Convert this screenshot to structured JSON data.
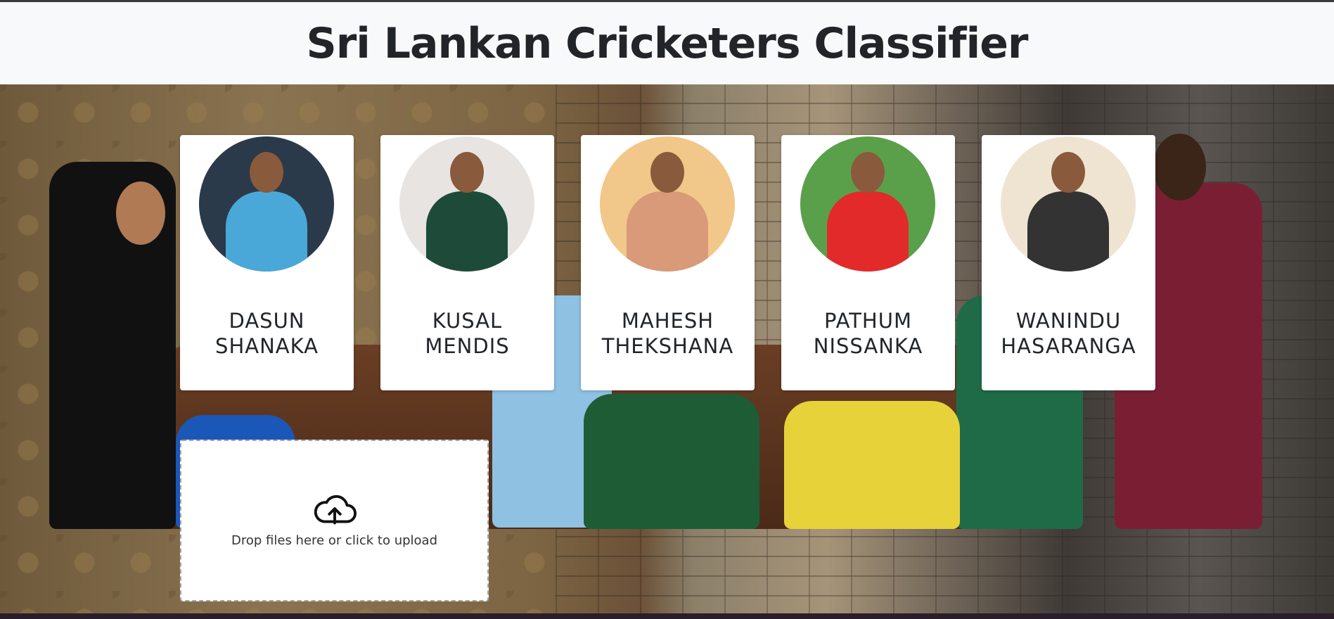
{
  "header": {
    "title": "Sri Lankan Cricketers Classifier"
  },
  "players": [
    {
      "first": "DASUN",
      "last": "SHANAKA",
      "bg": "#2a3a4a",
      "shirt": "#4aa8d8"
    },
    {
      "first": "KUSAL",
      "last": "MENDIS",
      "bg": "#e8e4e2",
      "shirt": "#1e4a3a"
    },
    {
      "first": "MAHESH",
      "last": "THEKSHANA",
      "bg": "#f2c78a",
      "shirt": "#d89a78"
    },
    {
      "first": "PATHUM",
      "last": "NISSANKA",
      "bg": "#5aa04a",
      "shirt": "#e32a2a"
    },
    {
      "first": "WANINDU",
      "last": "HASARANGA",
      "bg": "#efe4d2",
      "shirt": "#333333"
    }
  ],
  "upload": {
    "message": "Drop files here or click to upload",
    "icon": "cloud-upload-icon"
  }
}
